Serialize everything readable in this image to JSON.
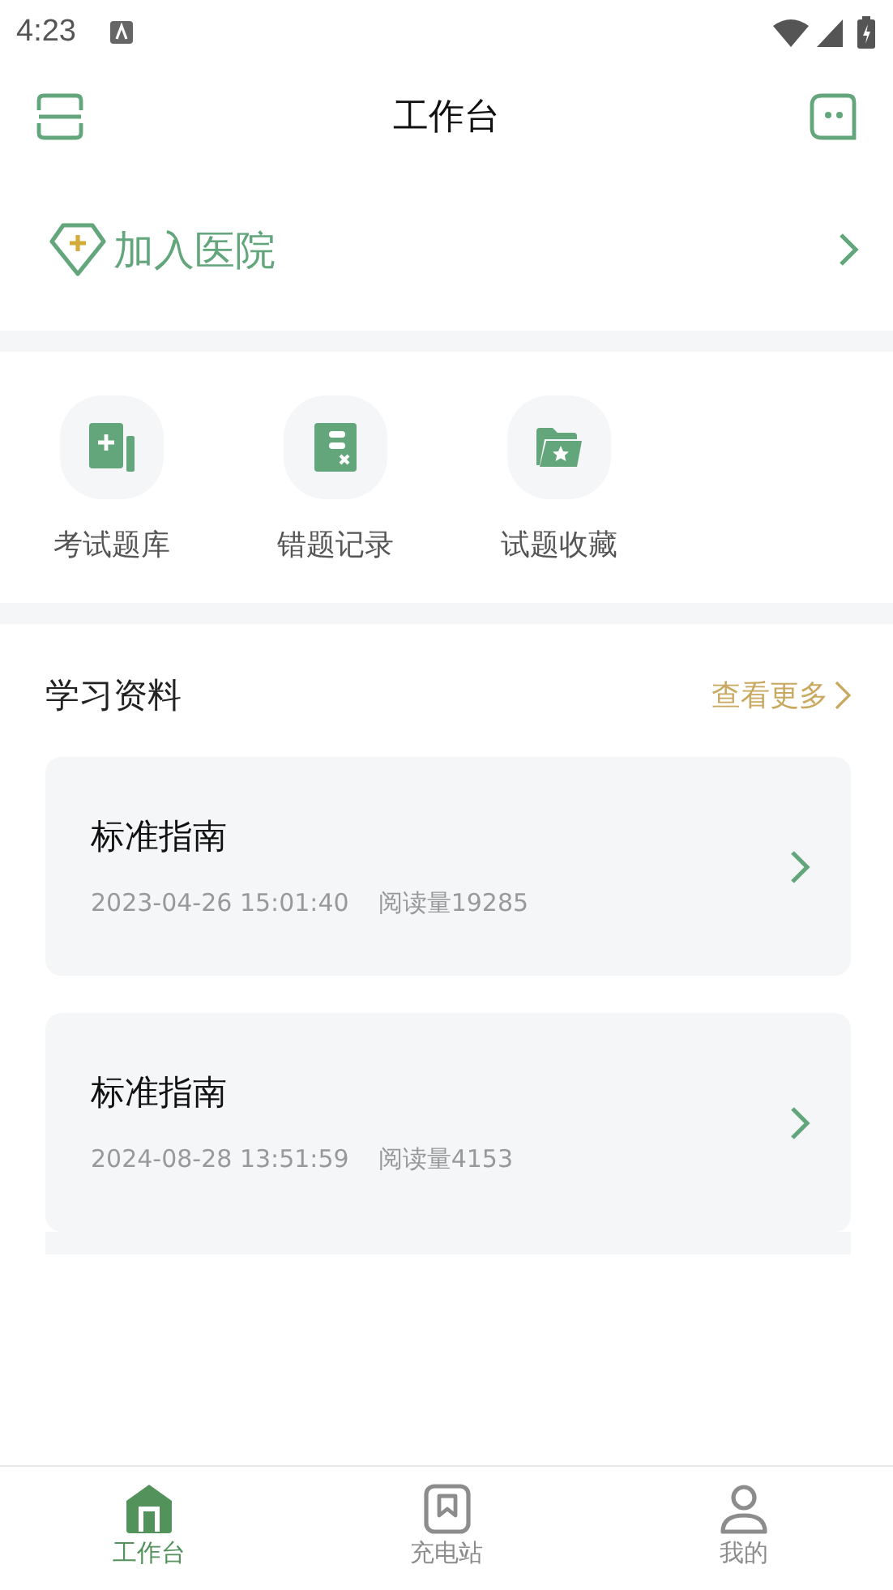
{
  "status_bar": {
    "time": "4:23"
  },
  "header": {
    "title": "工作台"
  },
  "join_hospital": {
    "label": "加入医院"
  },
  "shortcuts": [
    {
      "label": "考试题库"
    },
    {
      "label": "错题记录"
    },
    {
      "label": "试题收藏"
    }
  ],
  "materials": {
    "title": "学习资料",
    "more": "查看更多",
    "items": [
      {
        "title": "标准指南",
        "date": "2023-04-26 15:01:40",
        "reads": "阅读量19285"
      },
      {
        "title": "标准指南",
        "date": "2024-08-28 13:51:59",
        "reads": "阅读量4153"
      }
    ]
  },
  "tabs": [
    {
      "label": "工作台",
      "selected": true
    },
    {
      "label": "充电站",
      "selected": false
    },
    {
      "label": "我的",
      "selected": false
    }
  ]
}
